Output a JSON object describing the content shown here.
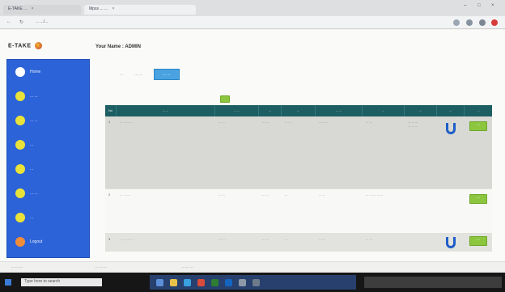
{
  "browser": {
    "tabs": [
      {
        "label": "E-TAKE ..."
      },
      {
        "label": "Mpss ... ..."
      }
    ],
    "url": "... .../...",
    "controls": {
      "minimize": "–",
      "maximize": "□",
      "close": "×"
    },
    "nav": {
      "back": "←",
      "reload": "↻"
    }
  },
  "app": {
    "brand": "E-TAKE",
    "user_line": "Your Name : ADMIN"
  },
  "sidebar": {
    "items": [
      {
        "label": "Home",
        "icon": "home-icon",
        "color": "#ffffff"
      },
      {
        "label": "... ...",
        "icon": "item-icon",
        "color": "#e9e23a"
      },
      {
        "label": "... ...",
        "icon": "item-icon",
        "color": "#e9e23a"
      },
      {
        "label": "...",
        "icon": "item-icon",
        "color": "#e9e23a"
      },
      {
        "label": "...",
        "icon": "item-icon",
        "color": "#e9e23a"
      },
      {
        "label": "... ...",
        "icon": "item-icon",
        "color": "#e9e23a"
      },
      {
        "label": "...",
        "icon": "item-icon",
        "color": "#e9e23a"
      },
      {
        "label": "Logout",
        "icon": "logout-icon",
        "color": "#f08c3a"
      }
    ]
  },
  "filters": {
    "tabs": [
      {
        "label": "...",
        "active": false
      },
      {
        "label": "... ...",
        "active": false
      },
      {
        "label": "... ...",
        "active": true
      }
    ]
  },
  "table": {
    "headers": [
      "No",
      "... ...",
      "... ...",
      "...",
      "...",
      "... ...",
      "...",
      "...",
      "...",
      "..."
    ],
    "rows": [
      {
        "no": "1",
        "col1": "... ... ... ...",
        "col2": "... ...",
        "col3": "... ...",
        "col4": "... ...",
        "col5": "... ... ...",
        "col6": "... ...",
        "col7": "... ... ... ... ... ...",
        "has_u": true
      },
      {
        "no": "2",
        "col1": "... ... ...",
        "col2": "... ...",
        "col3": "... ...",
        "col4": "...",
        "col5": "... ...",
        "col6": "... ... ... ... ...",
        "col7": "",
        "has_u": false
      },
      {
        "no": "3",
        "col1": "... ... ... ...",
        "col2": "... ...",
        "col3": "... ...",
        "col4": "...",
        "col5": "... ...",
        "col6": "... ...",
        "col7": "",
        "has_u": true
      }
    ],
    "action_label": "..."
  },
  "downloads": [
    {
      "label": "... ... ..."
    },
    {
      "label": "... ... ..."
    },
    {
      "label": "... ... ..."
    }
  ],
  "taskbar": {
    "search_placeholder": "Type here to search"
  },
  "colors": {
    "sidebar": "#2c63d8",
    "table_header": "#1d5e63",
    "action_green": "#8cc63f",
    "active_tab": "#4aa3e0"
  }
}
